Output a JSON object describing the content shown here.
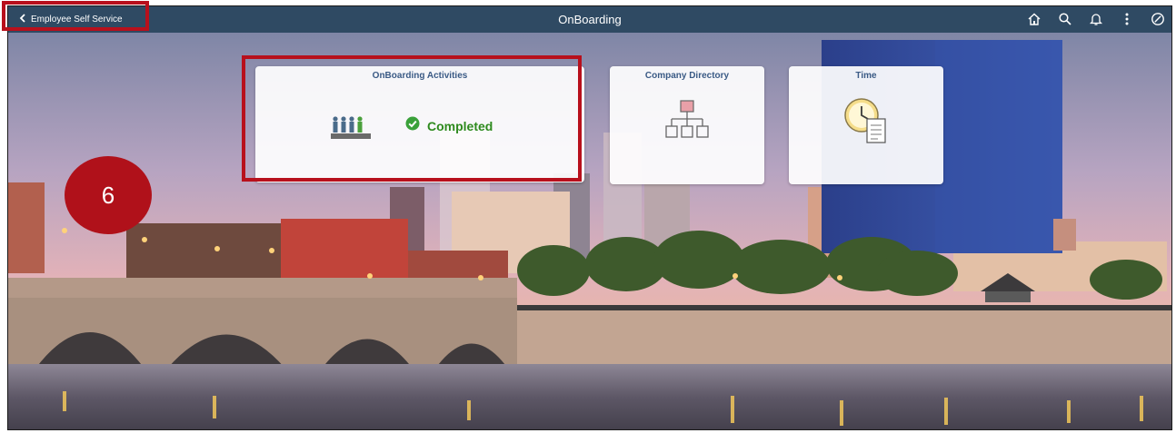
{
  "header": {
    "back_label": "Employee Self Service",
    "title": "OnBoarding",
    "icons": [
      "home-icon",
      "search-icon",
      "bell-icon",
      "more-icon",
      "compass-icon"
    ],
    "bar_color": "#2f4a63"
  },
  "tiles": [
    {
      "title": "OnBoarding Activities",
      "status": "Completed",
      "icon": "people-podium-icon"
    },
    {
      "title": "Company Directory",
      "icon": "org-chart-icon"
    },
    {
      "title": "Time",
      "icon": "clock-sheet-icon"
    }
  ],
  "annotation": {
    "step_number": "6",
    "highlight_color": "#b8101c"
  }
}
